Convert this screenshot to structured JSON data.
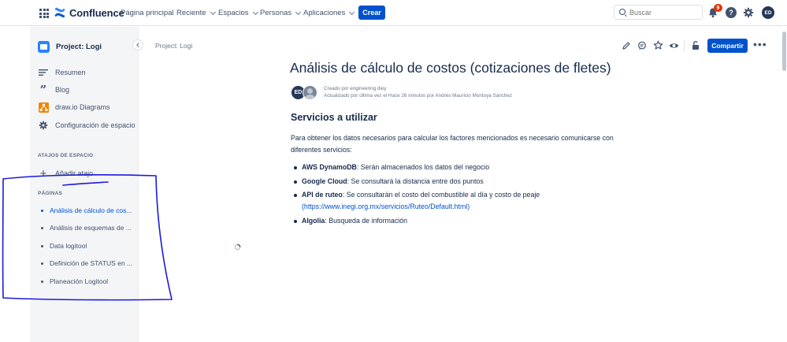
{
  "header": {
    "logo_text": "Confluence",
    "nav": [
      {
        "label": "Página principal",
        "dropdown": false
      },
      {
        "label": "Reciente",
        "dropdown": true
      },
      {
        "label": "Espacios",
        "dropdown": true
      },
      {
        "label": "Personas",
        "dropdown": true
      },
      {
        "label": "Aplicaciones",
        "dropdown": true
      }
    ],
    "create_label": "Crear",
    "search_placeholder": "Buscar",
    "notification_count": "9",
    "help_label": "?",
    "avatar_initials": "ED"
  },
  "sidebar": {
    "space_name": "Project: Logi",
    "items": [
      {
        "label": "Resumen",
        "icon": "summary-icon"
      },
      {
        "label": "Blog",
        "icon": "quote-icon"
      },
      {
        "label": "draw.io Diagrams",
        "icon": "drawio-icon"
      },
      {
        "label": "Configuración de espacio",
        "icon": "gear-icon"
      }
    ],
    "shortcuts_heading": "ATAJOS DE ESPACIO",
    "add_shortcut_label": "Añadir atajo",
    "pages_heading": "PÁGINAS",
    "pages": [
      {
        "label": "Análisis de cálculo de cos...",
        "active": true
      },
      {
        "label": "Análisis de esquemas de ...",
        "active": false
      },
      {
        "label": "Data logitool",
        "active": false
      },
      {
        "label": "Definición de STATUS en ...",
        "active": false
      },
      {
        "label": "Planeación Logitool",
        "active": false
      }
    ]
  },
  "page": {
    "breadcrumb": "Project: Logi",
    "share_label": "Compartir",
    "title": "Análisis de cálculo de costos (cotizaciones de fletes)",
    "author_initials": "ED",
    "created_by": "Creado por engineering diey",
    "updated_by": "Actualizado por última vez el Hace 26 minutos por Andrés Mauricio Montoya Sánchez",
    "section_heading": "Servicios a utilizar",
    "intro": "Para obtener los datos necesarios para calcular los factores mencionados es necesario comunicarse con diferentes servicios:",
    "bullets": [
      {
        "term": "AWS DynamoDB",
        "text": ": Serán almacenados los datos del negocio"
      },
      {
        "term": "Google Cloud",
        "text": ": Se consultará la distancia entre dos  puntos"
      },
      {
        "term": "API de ruteo",
        "text": ": Se consultarán el costo del combustible al día y costo de peaje",
        "link": "(https://www.inegi.org.mx/servicios/Ruteo/Default.html)"
      },
      {
        "term": "Algolia",
        "text": ": Busqueda de información"
      }
    ]
  },
  "colors": {
    "brand": "#0052cc",
    "annotation": "#1a1adb",
    "badge": "#de350b"
  }
}
